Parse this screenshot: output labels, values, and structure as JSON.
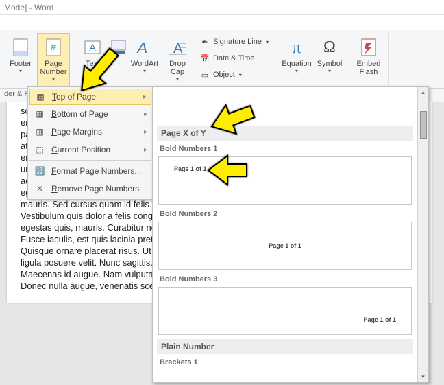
{
  "title": "Mode] - Word",
  "toolbar": {
    "footer": "Footer",
    "page_number": "Page\nNumber",
    "text_box": "Text\nBox",
    "quick_parts": "Quick Parts",
    "wordart": "WordArt",
    "drop_cap": "Drop\nCap",
    "signature": "Signature Line",
    "date_time": "Date & Time",
    "object": "Object",
    "equation": "Equation",
    "symbol": "Symbol",
    "flash": "Embed\nFlash"
  },
  "status": "der & F",
  "menu": {
    "top": "Top of Page",
    "bottom": "Bottom of Page",
    "margins": "Page Margins",
    "current": "Current Position",
    "format": "Format Page Numbers...",
    "remove": "Remove Page Numbers"
  },
  "gallery": {
    "group1": "Page X of Y",
    "bold1": "Bold Numbers 1",
    "bold2": "Bold Numbers 2",
    "bold3": "Bold Numbers 3",
    "preview_text": "Page 1 of 1",
    "group2": "Plain Number",
    "brackets1": "Brackets 1"
  },
  "doc": {
    "body": "sit amet lectus sit amet arcu molestie                                                       ctu\niaculis nibh, vitae scelerisque nunc massa eget pede. Sed velit urna, interdum vel, ultricies vel,\nfaucibus at, quam.\nDonec elit est, consectetuer eget, consequat quis, tempus quis, wisi. In in nunc. Class aptent taciti\nsociosqu ad litora torquent per conubia nostra, per inceptos hymenaeos. Donec ullamcorper fringilla\neros. Fusce in sapien eu purus dapibus commodo. Cum sociis natoque penatibus et magnis dis\nparturient montes, nascetur ridiculus mus. Cras faucibus condimentum odio. Sed ac ligula. Aliquam at\neros. Etiam at ligula et tellus ullamcorper ultrices. In fermentum, lorem non cursus porttitor, diam urna\naccumsan lacus, sed interdum wisi nibh nec nisl. Ut tincidunt volutpat urna. Mauris eleifend nulla eget\nmauris. Sed cursus quam id felis.\nVestibulum quis dolor a felis congue vehicula. Maecenas pede purus, tristique ac, tempus eget,\negestas quis, mauris. Curabitur non eros. Nullam hendrerit bibendum justo.\nFusce iaculis, est quis lacinia pretium, pede metus molestie lacus, at gravida wisi ante at libero.\nQuisque ornare placerat risus. Ut molestie magna at mi. Integer aliquet mauris et nibh. Ut mattis\nligula posuere velit. Nunc sagittis.\nMaecenas id augue. Nam vulputate. Duis a quam non neque lobortis malesuada. Praesent euismod.\nDonec nulla augue, venenatis scelerisque, dapibus a, consequat at, leo."
  }
}
